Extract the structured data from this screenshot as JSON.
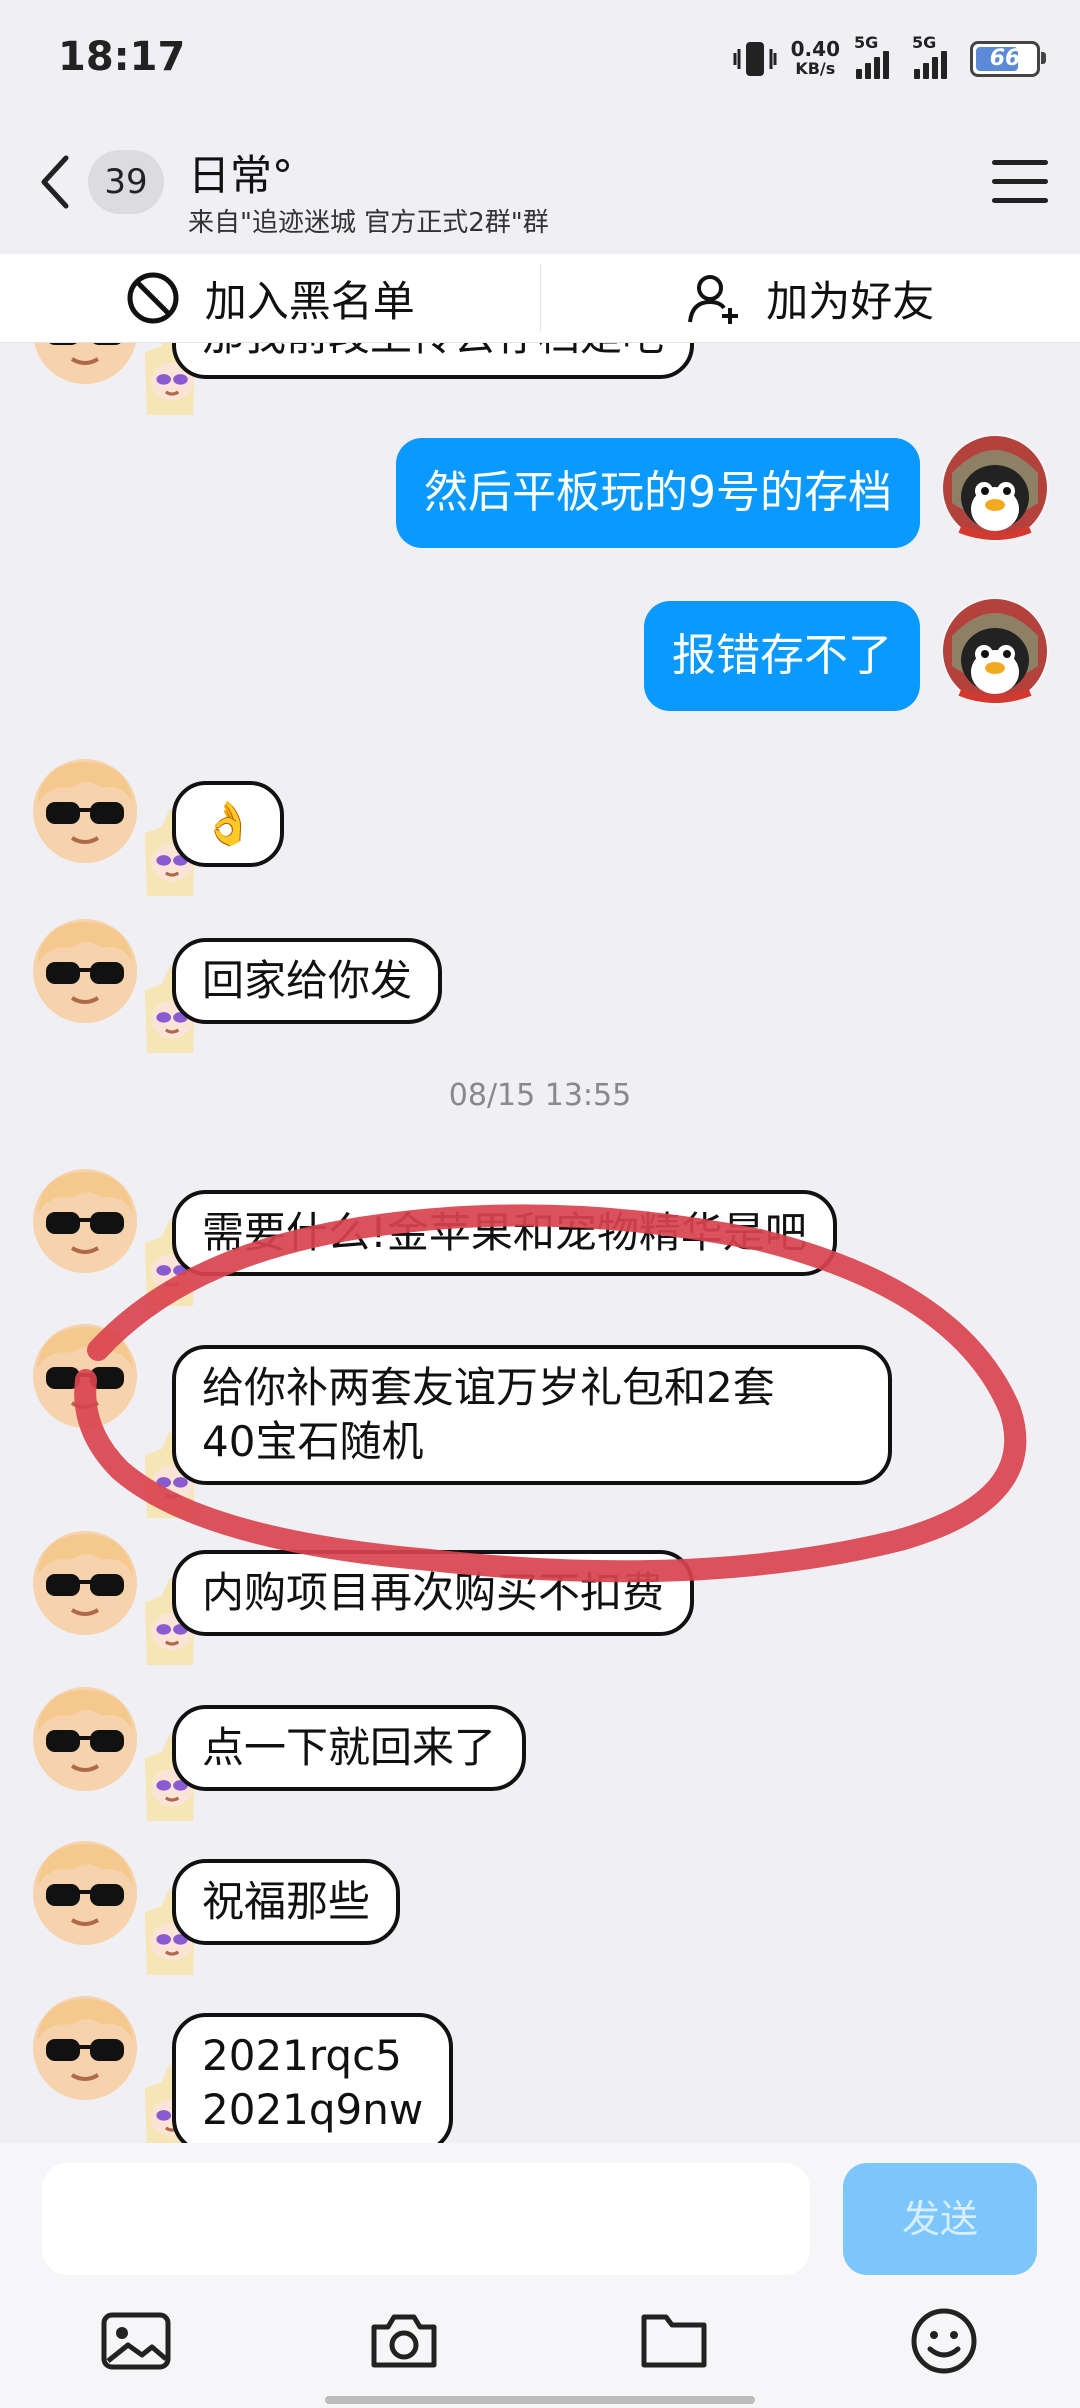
{
  "status_bar": {
    "time": "18:17",
    "net_speed_value": "0.40",
    "net_speed_unit": "KB/s",
    "signal1_label": "5G",
    "signal2_label": "5G",
    "battery_level": "66"
  },
  "header": {
    "unread_count": "39",
    "title": "日常°",
    "subtitle": "来自\"追迹迷城 官方正式2群\"群"
  },
  "actions": {
    "block_label": "加入黑名单",
    "add_friend_label": "加为好友"
  },
  "messages": [
    {
      "side": "left",
      "text": "那我前段上传去存档是吧"
    },
    {
      "side": "right",
      "text": "然后平板玩的9号的存档"
    },
    {
      "side": "right",
      "text": "报错存不了"
    },
    {
      "side": "left",
      "text": "👌"
    },
    {
      "side": "left",
      "text": "回家给你发"
    },
    {
      "side": "time",
      "text": "08/15 13:55"
    },
    {
      "side": "left",
      "text": "需要什么!金苹果和宠物精华是吧"
    },
    {
      "side": "left",
      "text": "给你补两套友谊万岁礼包和2套\n40宝石随机"
    },
    {
      "side": "left",
      "text": "内购项目再次购买不扣费"
    },
    {
      "side": "left",
      "text": "点一下就回来了"
    },
    {
      "side": "left",
      "text": "祝福那些"
    },
    {
      "side": "left",
      "text": "2021rqc5\n2021q9nw"
    }
  ],
  "input": {
    "value": "",
    "send_label": "发送"
  },
  "toolbar": [
    "image-icon",
    "camera-icon",
    "folder-icon",
    "emoji-icon"
  ],
  "colors": {
    "background": "#efeff4",
    "outgoing_bubble": "#0a99ff",
    "send_button": "#7cc6fb",
    "annotation_circle": "#d9434e"
  }
}
